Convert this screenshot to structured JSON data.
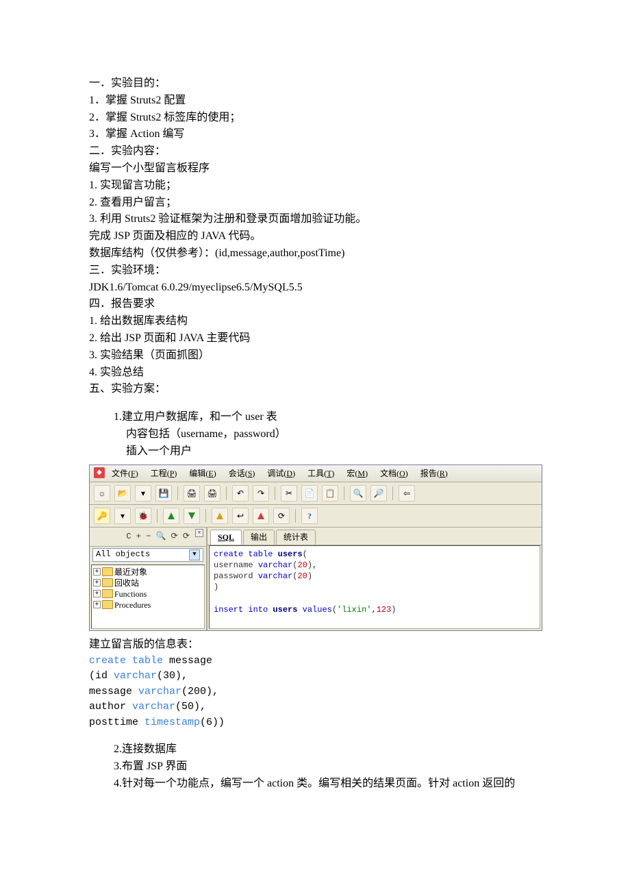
{
  "doc": {
    "s1_title": "一．实验目的：",
    "s1_1": "1．掌握 Struts2 配置",
    "s1_2": "2．掌握 Struts2 标签库的使用；",
    "s1_3": "3．掌握 Action 编写",
    "s2_title": "二．实验内容：",
    "s2_intro": "编写一个小型留言板程序",
    "s2_1": "1. 实现留言功能；",
    "s2_2": "2. 查看用户留言；",
    "s2_3": "3. 利用 Struts2 验证框架为注册和登录页面增加验证功能。",
    "s2_jsp": "完成 JSP 页面及相应的 JAVA 代码。",
    "s2_db": "数据库结构（仅供参考）：(id,message,author,postTime)",
    "s3_title": "三．实验环境：",
    "s3_env": "JDK1.6/Tomcat 6.0.29/myeclipse6.5/MySQL5.5",
    "s4_title": "四．报告要求",
    "s4_1": "1. 给出数据库表结构",
    "s4_2": "2. 给出 JSP 页面和 JAVA 主要代码",
    "s4_3": "3. 实验结果（页面抓图）",
    "s4_4": "4. 实验总结",
    "s5_title": "五、实验方案：",
    "step1_a": "1.建立用户数据库，和一个 user 表",
    "step1_b": "内容包括（username，password）",
    "step1_c": "插入一个用户",
    "msg_table_intro": "建立留言版的信息表：",
    "step2": "2.连接数据库",
    "step3": "3.布置 JSP 界面",
    "step4": "4.针对每一个功能点，编写一个 action 类。编写相关的结果页面。针对 action 返回的"
  },
  "ide": {
    "menubar": [
      "文件(F)",
      "工程(P)",
      "编辑(E)",
      "会话(S)",
      "调试(D)",
      "工具(T)",
      "宏(M)",
      "文档(O)",
      "报告(R)"
    ],
    "tree_select": "All objects",
    "tree_items": [
      "最近对象",
      "回收站",
      "Functions",
      "Procedures"
    ],
    "tabs": [
      "SQL",
      "输出",
      "统计表"
    ],
    "sql_lines": [
      [
        {
          "t": "create table ",
          "c": "e-blue"
        },
        {
          "t": "users",
          "c": "e-bold"
        },
        {
          "t": "(",
          "c": "e-gray"
        }
      ],
      [
        {
          "t": "username ",
          "c": "e-gray"
        },
        {
          "t": "varchar",
          "c": "e-blue"
        },
        {
          "t": "(",
          "c": "e-gray"
        },
        {
          "t": "20",
          "c": "e-red"
        },
        {
          "t": "),",
          "c": "e-gray"
        }
      ],
      [
        {
          "t": "password ",
          "c": "e-gray"
        },
        {
          "t": "varchar",
          "c": "e-blue"
        },
        {
          "t": "(",
          "c": "e-gray"
        },
        {
          "t": "20",
          "c": "e-red"
        },
        {
          "t": ")",
          "c": "e-gray"
        }
      ],
      [
        {
          "t": ")",
          "c": "e-gray"
        }
      ],
      [
        {
          "t": "",
          "c": "e-gray"
        }
      ],
      [
        {
          "t": "insert into ",
          "c": "e-blue"
        },
        {
          "t": "users",
          "c": "e-bold"
        },
        {
          "t": " values",
          "c": "e-blue"
        },
        {
          "t": "(",
          "c": "e-gray"
        },
        {
          "t": "'lixin'",
          "c": "e-green"
        },
        {
          "t": ",",
          "c": "e-gray"
        },
        {
          "t": "123",
          "c": "e-red"
        },
        {
          "t": ")",
          "c": "e-gray"
        }
      ]
    ]
  },
  "sql_message": {
    "l1_a": "create table",
    "l1_b": " message",
    "l2_a": "(",
    "l2_b": "id",
    "l2_c": " varchar",
    "l2_d": "(30),",
    "l3_a": " message ",
    "l3_b": "varchar",
    "l3_c": "(200),",
    "l4_a": " author ",
    "l4_b": "varchar",
    "l4_c": "(50),",
    "l5_a": " posttime ",
    "l5_b": "timestamp",
    "l5_c": "(6))"
  }
}
